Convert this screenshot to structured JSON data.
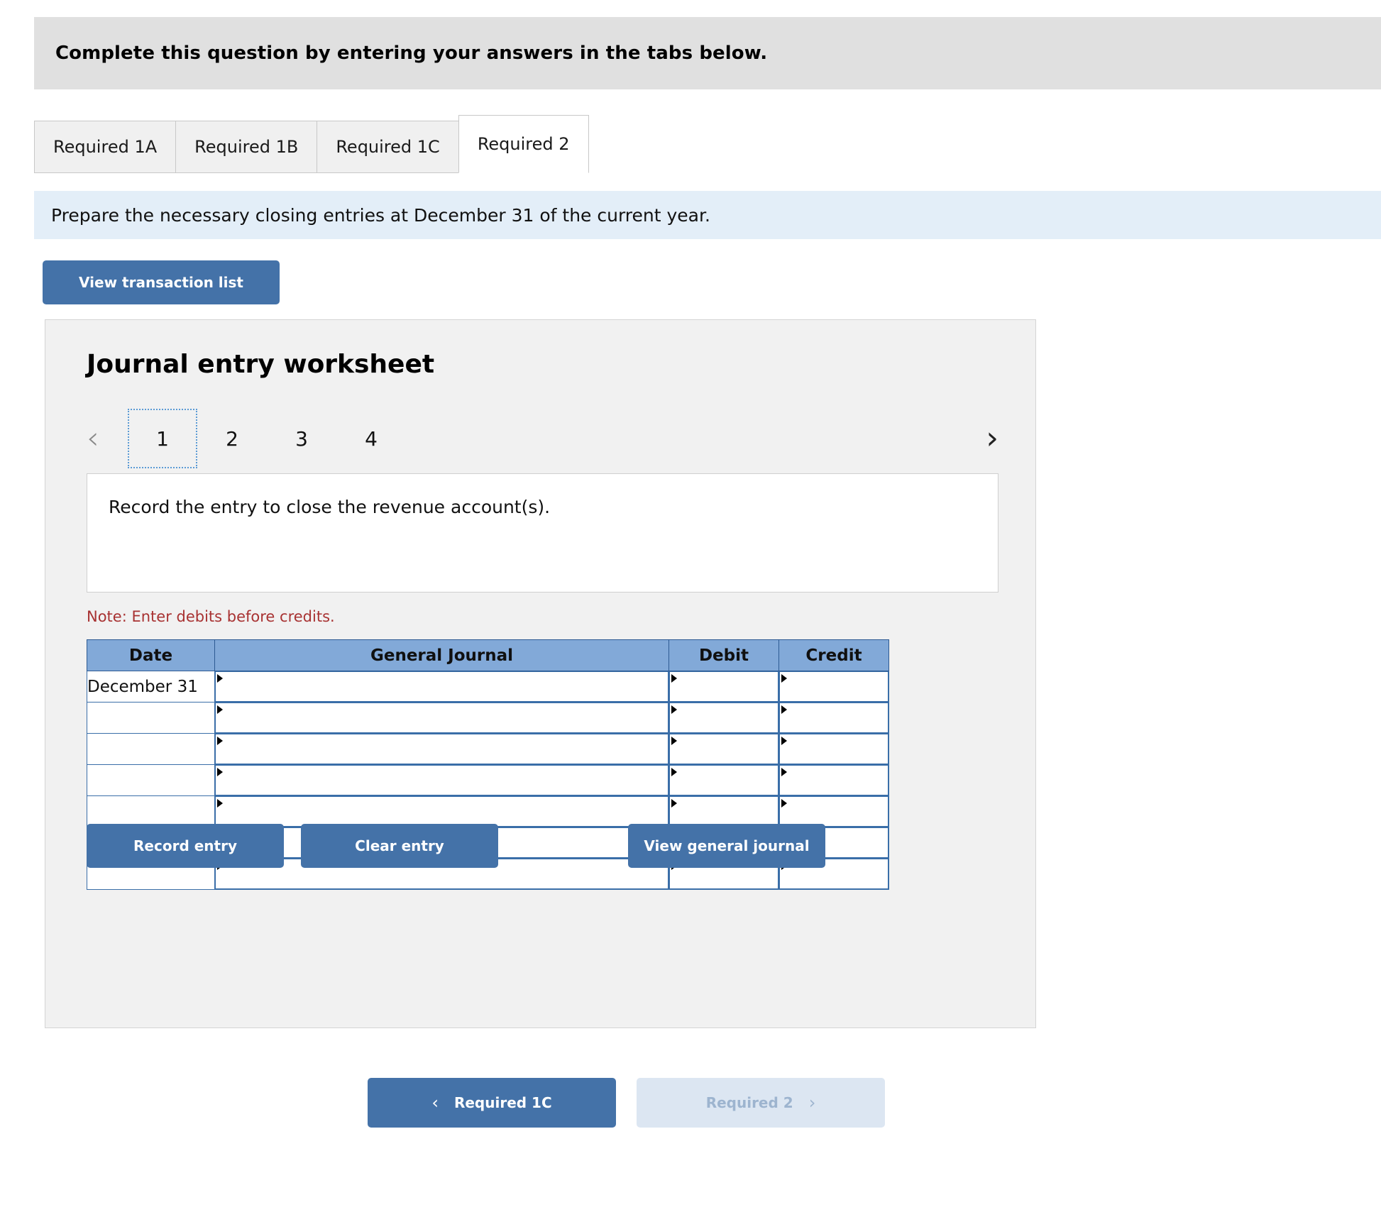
{
  "header": {
    "instruction": "Complete this question by entering your answers in the tabs below."
  },
  "tabs": [
    {
      "label": "Required 1A",
      "active": false
    },
    {
      "label": "Required 1B",
      "active": false
    },
    {
      "label": "Required 1C",
      "active": false
    },
    {
      "label": "Required 2",
      "active": true
    }
  ],
  "task_strip": {
    "text": "Prepare the necessary closing entries at December 31 of the current year."
  },
  "buttons": {
    "view_transaction_list": "View transaction list",
    "record_entry": "Record entry",
    "clear_entry": "Clear entry",
    "view_general_journal": "View general journal"
  },
  "worksheet": {
    "title": "Journal entry worksheet",
    "pager": {
      "prev_icon": "chevron-left-icon",
      "next_icon": "chevron-right-icon",
      "pages": [
        "1",
        "2",
        "3",
        "4"
      ],
      "selected": "1"
    },
    "prompt": "Record the entry to close the revenue account(s).",
    "note": "Note: Enter debits before credits."
  },
  "journal_table": {
    "columns": [
      "Date",
      "General Journal",
      "Debit",
      "Credit"
    ],
    "rows": [
      {
        "date": "December 31",
        "general_journal": "",
        "debit": "",
        "credit": ""
      },
      {
        "date": "",
        "general_journal": "",
        "debit": "",
        "credit": ""
      },
      {
        "date": "",
        "general_journal": "",
        "debit": "",
        "credit": ""
      },
      {
        "date": "",
        "general_journal": "",
        "debit": "",
        "credit": ""
      },
      {
        "date": "",
        "general_journal": "",
        "debit": "",
        "credit": ""
      },
      {
        "date": "",
        "general_journal": "",
        "debit": "",
        "credit": ""
      },
      {
        "date": "",
        "general_journal": "",
        "debit": "",
        "credit": ""
      }
    ]
  },
  "bottom_nav": {
    "prev_label": "Required 1C",
    "prev_icon": "chevron-left-icon",
    "next_label": "Required 2",
    "next_icon": "chevron-right-icon",
    "next_disabled": true
  },
  "colors": {
    "primary_blue": "#4472a8",
    "disabled_blue": "#dce6f2",
    "table_header_blue": "#82a9d8",
    "table_border_blue": "#3a6ea8",
    "banner_gray": "#e0e0e0",
    "panel_gray": "#f1f1f1",
    "strip_blue": "#e3eef8",
    "note_red": "#a83232"
  }
}
